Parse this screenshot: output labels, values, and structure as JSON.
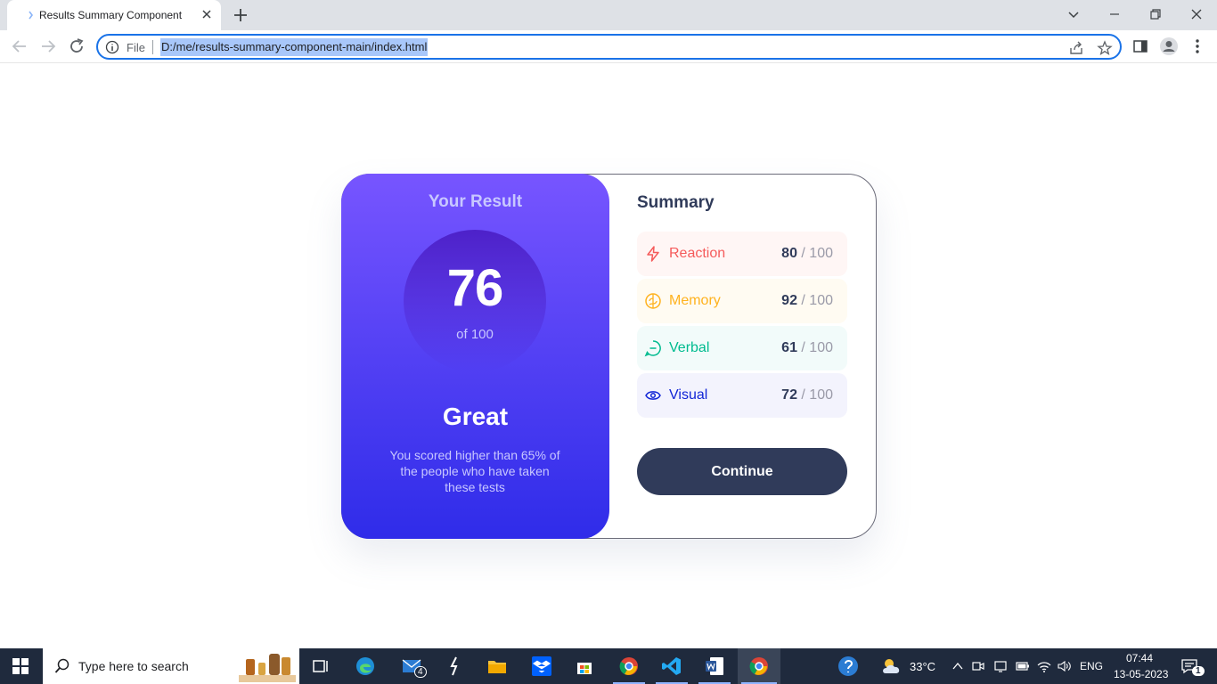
{
  "browser": {
    "tab_title": "Results Summary Component",
    "scheme_label": "File",
    "url": "D:/me/results-summary-component-main/index.html"
  },
  "result": {
    "heading": "Your Result",
    "score": "76",
    "total": "of 100",
    "rating": "Great",
    "description": "You scored higher than 65% of the people who have taken these tests"
  },
  "summary": {
    "title": "Summary",
    "items": [
      {
        "label": "Reaction",
        "score": "80",
        "max": " / 100",
        "icon": "lightning-icon",
        "color": "#f55b5b",
        "bg": "#fff6f5"
      },
      {
        "label": "Memory",
        "score": "92",
        "max": " / 100",
        "icon": "brain-icon",
        "color": "#ffb21e",
        "bg": "#fffbf2"
      },
      {
        "label": "Verbal",
        "score": "61",
        "max": " / 100",
        "icon": "chat-icon",
        "color": "#00bb8f",
        "bg": "#f2fbfa"
      },
      {
        "label": "Visual",
        "score": "72",
        "max": " / 100",
        "icon": "eye-icon",
        "color": "#1125d6",
        "bg": "#f3f3fd"
      }
    ],
    "continue_label": "Continue"
  },
  "taskbar": {
    "search_placeholder": "Type here to search",
    "mail_badge": "4",
    "temperature": "33°C",
    "language": "ENG",
    "time": "07:44",
    "date": "13-05-2023",
    "notification_count": "1"
  }
}
